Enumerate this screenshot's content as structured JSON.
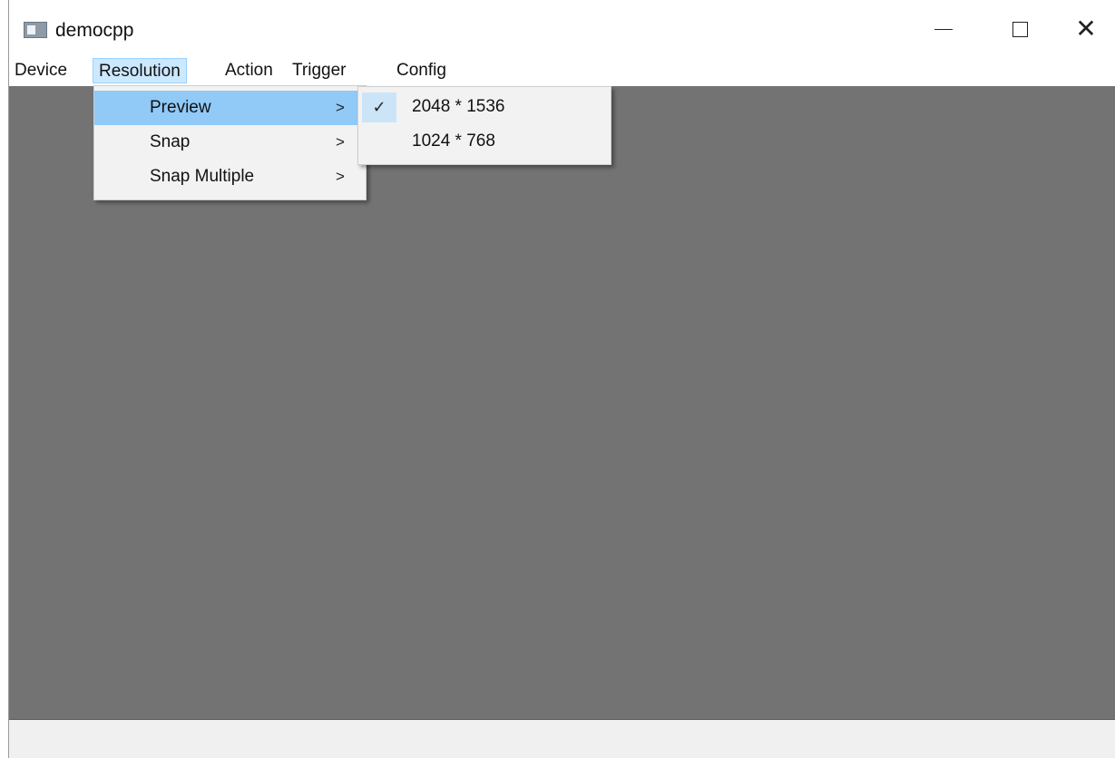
{
  "window": {
    "title": "democpp",
    "icon": "app-window-icon",
    "controls": {
      "minimize_icon": "minimize-icon",
      "maximize_icon": "maximize-icon",
      "close_icon": "close-icon",
      "close_glyph": "✕"
    }
  },
  "menubar": {
    "items": [
      {
        "label": "Device"
      },
      {
        "label": "Resolution",
        "active": true
      },
      {
        "label": "Action"
      },
      {
        "label": "Trigger"
      },
      {
        "label": "Config"
      }
    ]
  },
  "resolution_menu": {
    "items": [
      {
        "label": "Preview",
        "highlighted": true,
        "submenu": true,
        "arrow": ">"
      },
      {
        "label": "Snap",
        "submenu": true,
        "arrow": ">"
      },
      {
        "label": "Snap Multiple",
        "submenu": true,
        "arrow": ">"
      }
    ]
  },
  "preview_submenu": {
    "check_glyph": "✓",
    "items": [
      {
        "label": "2048 * 1536",
        "checked": true
      },
      {
        "label": "1024 * 768",
        "checked": false
      }
    ]
  },
  "colors": {
    "main_area": "#737373",
    "menu_active_bg": "#cce8ff",
    "menu_highlight_bg": "#91c9f7",
    "dropdown_bg": "#f2f2f2",
    "statusbar_bg": "#f0f0f0"
  }
}
